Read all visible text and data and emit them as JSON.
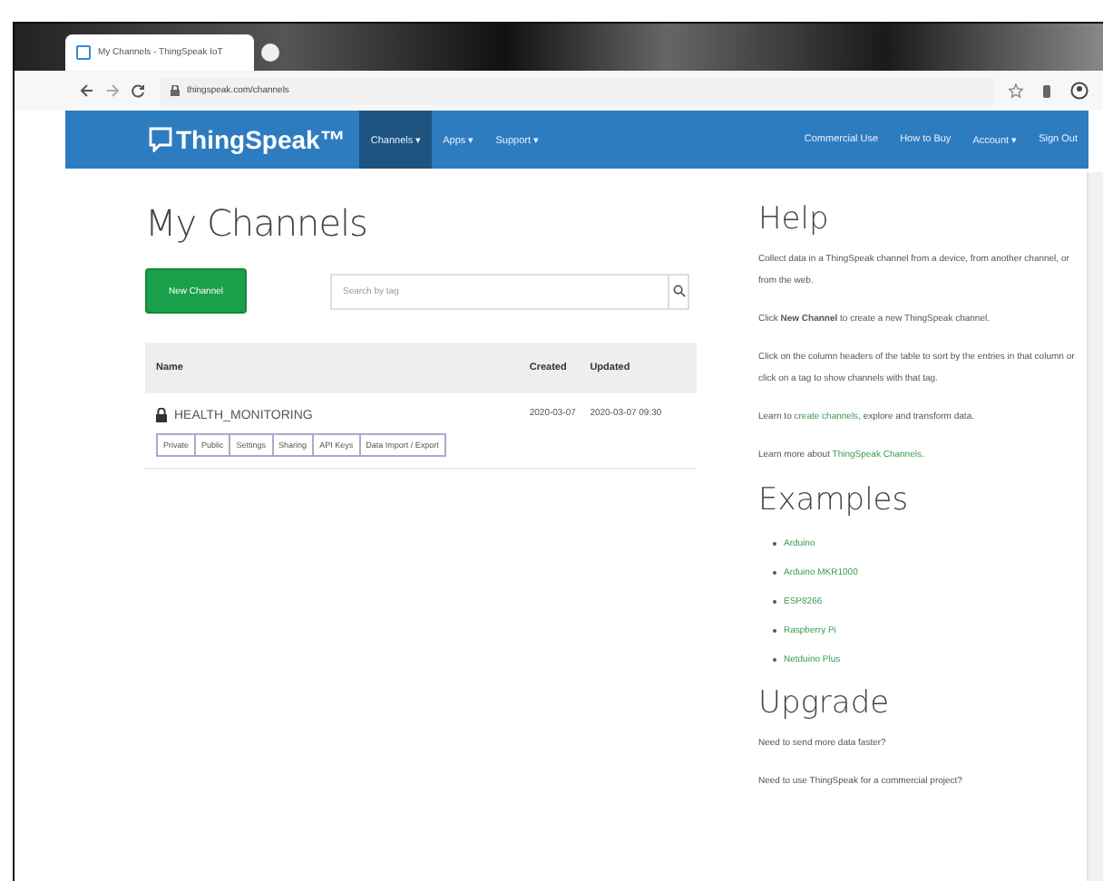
{
  "browser": {
    "tab_title": "My Channels - ThingSpeak IoT",
    "url": "thingspeak.com/channels"
  },
  "navbar": {
    "logo": "ThingSpeak™",
    "left_items": [
      {
        "label": "Channels ▾",
        "selected": true
      },
      {
        "label": "Apps ▾",
        "selected": false
      },
      {
        "label": "Support ▾",
        "selected": false
      }
    ],
    "right_items": [
      "Commercial Use",
      "How to Buy",
      "Account ▾",
      "Sign Out"
    ]
  },
  "main": {
    "title": "My Channels",
    "new_channel_button": "New Channel",
    "search": {
      "placeholder": "Search by tag"
    },
    "table": {
      "columns": [
        "Name",
        "Created",
        "Updated"
      ],
      "rows": [
        {
          "name": "HEALTH_MONITORING",
          "created": "2020-03-07",
          "updated": "2020-03-07 09:30",
          "private": true,
          "actions": [
            "Private",
            "Public",
            "Settings",
            "Sharing",
            "API Keys",
            "Data Import / Export"
          ]
        }
      ]
    }
  },
  "help": {
    "title": "Help",
    "paragraphs": [
      "Collect data in a ThingSpeak channel from a device, from another channel, or from the web.",
      "Click **New Channel** to create a new ThingSpeak channel.",
      "Click on the column headers of the table to sort by the entries in that column or click on a tag to show channels with that tag."
    ],
    "learn": [
      {
        "before": "Learn to ",
        "link": "create channels",
        "after": ", explore and transform data."
      },
      {
        "before": "Learn more about ",
        "link": "ThingSpeak Channels",
        "after": "."
      }
    ],
    "examples_title": "Examples",
    "examples": [
      "Arduino",
      "Arduino MKR1000",
      "ESP8266",
      "Raspberry Pi",
      "Netduino Plus"
    ],
    "upgrade_title": "Upgrade",
    "upgrade": [
      "Need to send more data faster?",
      "Need to use ThingSpeak for a commercial project?"
    ]
  }
}
